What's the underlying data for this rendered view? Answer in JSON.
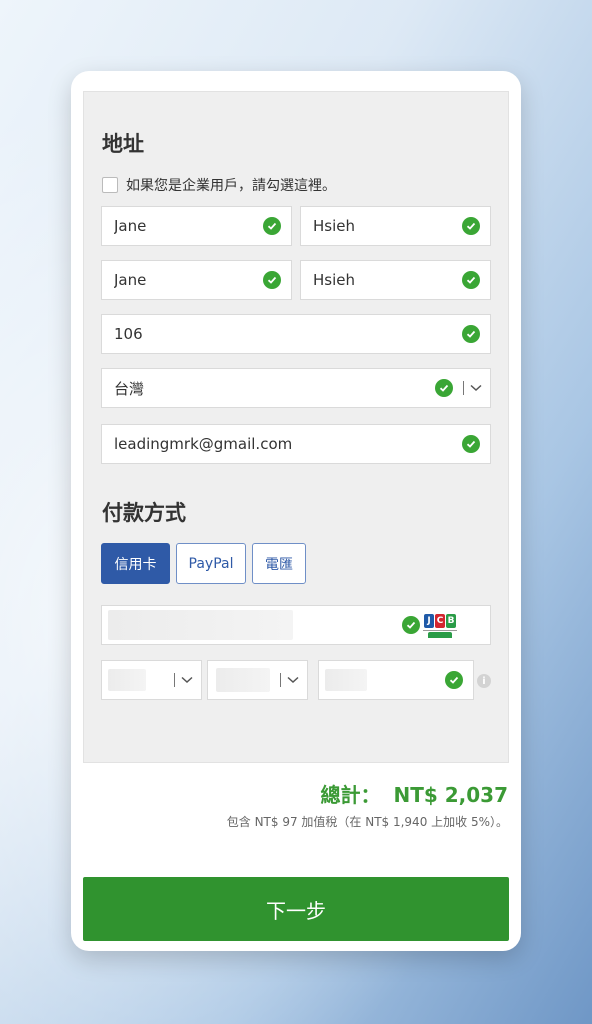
{
  "address": {
    "title": "地址",
    "business_checkbox_label": "如果您是企業用戶，請勾選這裡。",
    "first_name": "Jane",
    "last_name": "Hsieh",
    "first_name_2": "Jane",
    "last_name_2": "Hsieh",
    "postal_code": "106",
    "country": "台灣",
    "email": "leadingmrk@gmail.com"
  },
  "payment": {
    "title": "付款方式",
    "methods": [
      {
        "label": "信用卡",
        "active": true
      },
      {
        "label": "PayPal",
        "active": false
      },
      {
        "label": "電匯",
        "active": false
      }
    ],
    "card_brand_icon": "jcb-logo-icon"
  },
  "summary": {
    "total_label": "總計：",
    "total_value": "NT$ 2,037",
    "tax_note": "包含 NT$ 97 加值稅（在 NT$ 1,940 上加收 5%）。"
  },
  "actions": {
    "next_label": "下一步"
  },
  "colors": {
    "accent_green": "#30932f",
    "check_green": "#3aa635",
    "primary_blue": "#2f5aa7"
  }
}
